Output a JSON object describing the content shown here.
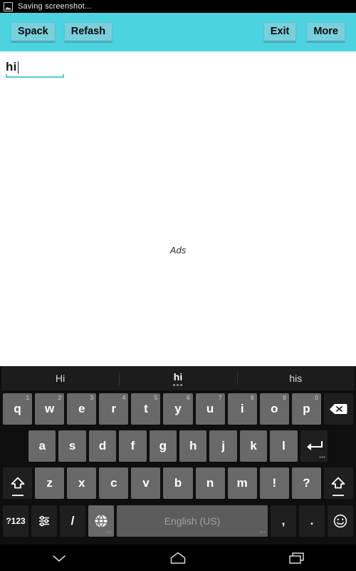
{
  "status_bar": {
    "icon": "screenshot-image-icon",
    "text": "Saving screenshot..."
  },
  "toolbar": {
    "background_color": "#4bd3e0",
    "button_color": "#79cfdc",
    "left_buttons": [
      {
        "label": "Spack",
        "name": "spack-button"
      },
      {
        "label": "Refash",
        "name": "refash-button"
      }
    ],
    "right_buttons": [
      {
        "label": "Exit",
        "name": "exit-button"
      },
      {
        "label": "More",
        "name": "more-button"
      }
    ]
  },
  "content": {
    "input": {
      "value": "hi",
      "placeholder": "",
      "underline_color": "#56c8da"
    },
    "ads_label": "Ads"
  },
  "keyboard": {
    "suggestions": [
      {
        "label": "Hi",
        "selected": false
      },
      {
        "label": "hi",
        "selected": true
      },
      {
        "label": "his",
        "selected": false
      }
    ],
    "row1": [
      {
        "label": "q",
        "hint": "1"
      },
      {
        "label": "w",
        "hint": "2"
      },
      {
        "label": "e",
        "hint": "3"
      },
      {
        "label": "r",
        "hint": "4"
      },
      {
        "label": "t",
        "hint": "5"
      },
      {
        "label": "y",
        "hint": "6"
      },
      {
        "label": "u",
        "hint": "7"
      },
      {
        "label": "i",
        "hint": "8"
      },
      {
        "label": "o",
        "hint": "9"
      },
      {
        "label": "p",
        "hint": "0"
      }
    ],
    "backspace_icon": "backspace-icon",
    "row2": [
      {
        "label": "a"
      },
      {
        "label": "s"
      },
      {
        "label": "d"
      },
      {
        "label": "f"
      },
      {
        "label": "g"
      },
      {
        "label": "h"
      },
      {
        "label": "j"
      },
      {
        "label": "k"
      },
      {
        "label": "l"
      }
    ],
    "enter_icon": "enter-icon",
    "row3": [
      {
        "label": "z"
      },
      {
        "label": "x"
      },
      {
        "label": "c"
      },
      {
        "label": "v"
      },
      {
        "label": "b"
      },
      {
        "label": "n"
      },
      {
        "label": "m"
      },
      {
        "label": "!"
      },
      {
        "label": "?"
      }
    ],
    "shift_icon": "shift-icon",
    "row4": {
      "symbols_label": "?123",
      "settings_icon": "keyboard-settings-icon",
      "slash_label": "/",
      "globe_icon": "language-globe-icon",
      "space_label": "English (US)",
      "comma_label": ",",
      "period_label": ".",
      "emoji_icon": "emoji-smiley-icon"
    }
  },
  "navbar": {
    "back_icon": "hide-keyboard-chevron-down-icon",
    "home_icon": "home-icon",
    "recents_icon": "recent-apps-icon"
  }
}
